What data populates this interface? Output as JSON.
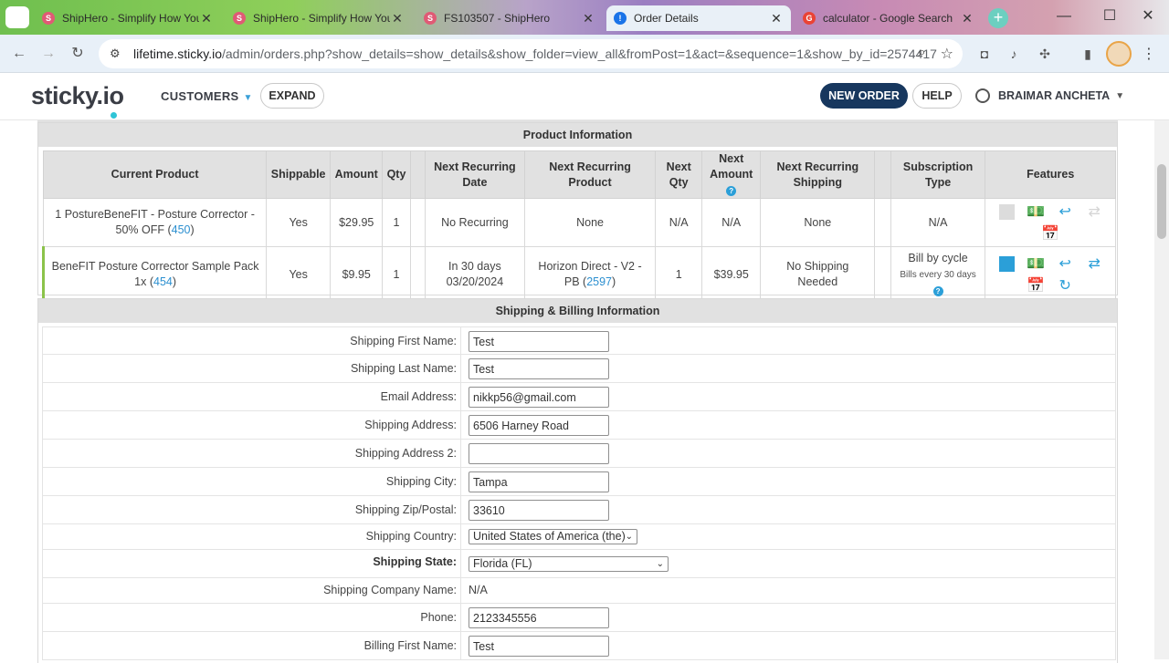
{
  "browser": {
    "tabs": [
      {
        "label": "ShipHero - Simplify How You",
        "color": "#e05a75",
        "glyph": "S"
      },
      {
        "label": "ShipHero - Simplify How You",
        "color": "#e05a75",
        "glyph": "S"
      },
      {
        "label": "FS103507 - ShipHero",
        "color": "#e05a75",
        "glyph": "S"
      },
      {
        "label": "Order Details",
        "color": "#1a73e8",
        "glyph": "!"
      },
      {
        "label": "calculator - Google Search",
        "color": "#ea4335",
        "glyph": "G"
      }
    ],
    "url_domain": "lifetime.sticky.io",
    "url_path": "/admin/orders.php?show_details=show_details&show_folder=view_all&fromPost=1&act=&sequence=1&show_by_id=2574417"
  },
  "header": {
    "logo": "sticky.io",
    "customers_label": "CUSTOMERS",
    "expand_label": "EXPAND",
    "new_order_label": "NEW ORDER",
    "help_label": "HELP",
    "user_name": "BRAIMAR ANCHETA"
  },
  "product_section": {
    "title": "Product Information",
    "columns": [
      "Current Product",
      "Shippable",
      "Amount",
      "Qty",
      "",
      "Next Recurring Date",
      "Next Recurring Product",
      "Next Qty",
      "Next Amount",
      "Next Recurring Shipping",
      "",
      "Subscription Type",
      "Features"
    ],
    "rows": [
      {
        "product": "1 PostureBeneFIT - Posture Corrector - 50% OFF (",
        "product_id": "450",
        "shippable": "Yes",
        "amount": "$29.95",
        "qty": "1",
        "next_date_line1": "No Recurring",
        "next_date_line2": "",
        "next_product": "None",
        "next_product_id": "",
        "next_qty": "N/A",
        "next_amount": "N/A",
        "next_shipping": "None",
        "sub_type": "N/A",
        "sub_detail": ""
      },
      {
        "product": "BeneFIT Posture Corrector Sample Pack 1x (",
        "product_id": "454",
        "shippable": "Yes",
        "amount": "$9.95",
        "qty": "1",
        "next_date_line1": "In 30 days",
        "next_date_line2": "03/20/2024",
        "next_product": "Horizon Direct - V2 - PB (",
        "next_product_id": "2597",
        "next_qty": "1",
        "next_amount": "$39.95",
        "next_shipping": "No Shipping Needed",
        "sub_type": "Bill by cycle",
        "sub_detail": "Bills every 30 days"
      }
    ]
  },
  "shipping_section": {
    "title": "Shipping & Billing Information",
    "fields": {
      "first_name": {
        "label": "Shipping First Name:",
        "value": "Test"
      },
      "last_name": {
        "label": "Shipping Last Name:",
        "value": "Test"
      },
      "email": {
        "label": "Email Address:",
        "value": "nikkp56@gmail.com"
      },
      "address": {
        "label": "Shipping Address:",
        "value": "6506 Harney Road"
      },
      "address2": {
        "label": "Shipping Address 2:",
        "value": ""
      },
      "city": {
        "label": "Shipping City:",
        "value": "Tampa"
      },
      "zip": {
        "label": "Shipping Zip/Postal:",
        "value": "33610"
      },
      "country": {
        "label": "Shipping Country:",
        "value": "United States of America (the)"
      },
      "state": {
        "label": "Shipping State:",
        "value": "Florida (FL)"
      },
      "company": {
        "label": "Shipping Company Name:",
        "value": "N/A"
      },
      "phone": {
        "label": "Phone:",
        "value": "2123345556"
      },
      "billing_first_name": {
        "label": "Billing First Name:",
        "value": "Test"
      }
    }
  },
  "colors": {
    "brand_navy": "#17375e",
    "accent_blue": "#2b9fd8",
    "active_row": "#8bc34a"
  }
}
